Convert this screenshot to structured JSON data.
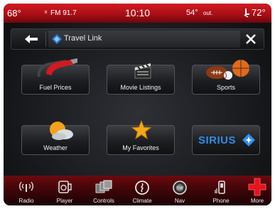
{
  "status_bar": {
    "inside_temp": "68°",
    "radio": "FM 91.7",
    "time": "10:10",
    "outside_temp": "54°",
    "outside_label": "out.",
    "set_temp": "72°"
  },
  "header": {
    "title": "Travel Link"
  },
  "tiles": [
    {
      "label": "Fuel Prices",
      "icon": "fuel-pump-icon"
    },
    {
      "label": "Movie Listings",
      "icon": "clapperboard-icon"
    },
    {
      "label": "Sports",
      "icon": "sports-balls-icon"
    },
    {
      "label": "Weather",
      "icon": "weather-icon"
    },
    {
      "label": "My Favorites",
      "icon": "star-icon"
    },
    {
      "label": "SIRIUS",
      "icon": "sirius-logo"
    }
  ],
  "bottom_nav": [
    {
      "label": "Radio",
      "icon": "radio-icon"
    },
    {
      "label": "Player",
      "icon": "player-icon"
    },
    {
      "label": "Controls",
      "icon": "controls-icon"
    },
    {
      "label": "Climate",
      "icon": "climate-icon"
    },
    {
      "label": "Nav",
      "icon": "nav-icon"
    },
    {
      "label": "Phone",
      "icon": "phone-icon"
    },
    {
      "label": "More",
      "icon": "plus-icon"
    }
  ],
  "colors": {
    "accent_red": "#c8141c",
    "header_blue": "#2a7fd4",
    "star_gold": "#f2a81a"
  }
}
